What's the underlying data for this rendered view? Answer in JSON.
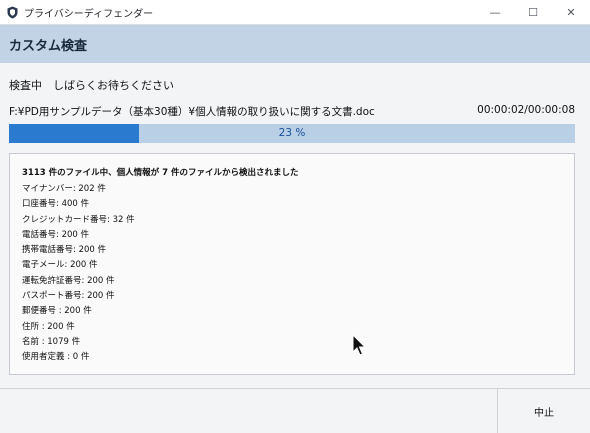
{
  "window": {
    "title": "プライバシーディフェンダー",
    "minimize_glyph": "—",
    "maximize_glyph": "☐",
    "close_glyph": "✕"
  },
  "header": {
    "title": "カスタム検査"
  },
  "scan": {
    "status": "検査中　しばらくお待ちください",
    "current_file": "F:¥PD用サンプルデータ（基本30種）¥個人情報の取り扱いに関する文書.doc",
    "elapsed": "00:00:02/00:00:08",
    "progress_percent": 23,
    "progress_label": "23 %"
  },
  "results": {
    "summary": "3113 件のファイル中、個人情報が 7 件のファイルから検出されました",
    "items": [
      "マイナンバー: 202 件",
      "口座番号: 400 件",
      "クレジットカード番号: 32 件",
      "電話番号: 200 件",
      "携帯電話番号: 200 件",
      "電子メール: 200 件",
      "運転免許証番号: 200 件",
      "パスポート番号: 200 件",
      "郵便番号 : 200 件",
      "住所 : 200 件",
      "名前 : 1079 件",
      "使用者定義 : 0 件"
    ]
  },
  "footer": {
    "stop_label": "中止"
  },
  "icons": {
    "app": "shield-icon",
    "cursor": "mouse-pointer-icon"
  },
  "colors": {
    "header_bg": "#c3d3e6",
    "progress_fill": "#2a7bd0",
    "progress_track": "#b8cfe6"
  }
}
